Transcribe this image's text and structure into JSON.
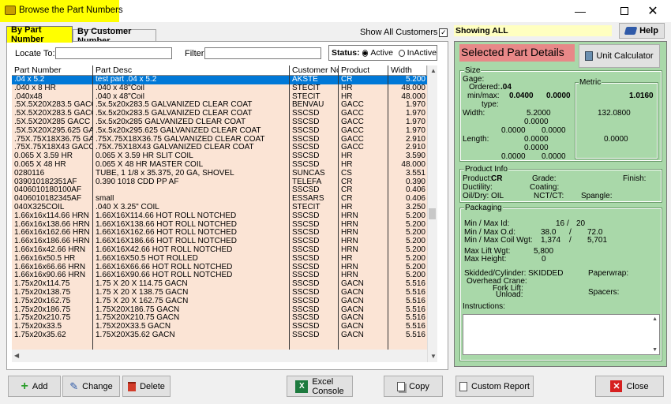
{
  "window": {
    "title": "Browse the Part Numbers"
  },
  "tabs": {
    "by_part": "By Part Number",
    "by_customer": "By Customer Number"
  },
  "show_all_customers": "Show All Customers",
  "locate_label": "Locate To:",
  "filter_label": "Filter:",
  "status": {
    "label": "Status:",
    "active": "Active",
    "inactive": "InActive"
  },
  "columns": [
    "Part Number",
    "Part Desc",
    "Customer No",
    "Product",
    "Width"
  ],
  "rows": [
    {
      "part": ".04 x 5.2",
      "desc": "test part .04 x 5.2",
      "cust": "AKSTE",
      "prod": "CR",
      "width": "5.200"
    },
    {
      "part": ".040 x 8 HR",
      "desc": ".040 x 48\"Coil",
      "cust": "STECIT",
      "prod": "HR",
      "width": "48.000"
    },
    {
      "part": ".040x48",
      "desc": ".040 x 48\"Coil",
      "cust": "STECIT",
      "prod": "HR",
      "width": "48.000"
    },
    {
      "part": ".5X.5X20X283.5 GACC",
      "desc": ".5x.5x20x283.5 GALVANIZED CLEAR COAT",
      "cust": "BENVAU",
      "prod": "GACC",
      "width": "1.970"
    },
    {
      "part": ".5X.5X20X283.5 GACC",
      "desc": ".5x.5x20x283.5 GALVANIZED CLEAR COAT",
      "cust": "SSCSD",
      "prod": "GACC",
      "width": "1.970"
    },
    {
      "part": ".5X.5X20X285 GACC",
      "desc": ".5x.5x20x285 GALVANIZED CLEAR COAT",
      "cust": "SSCSD",
      "prod": "GACC",
      "width": "1.970"
    },
    {
      "part": ".5X.5X20X295.625 GACC",
      "desc": ".5x.5x20x295.625 GALVANIZED CLEAR COAT",
      "cust": "SSCSD",
      "prod": "GACC",
      "width": "1.970"
    },
    {
      "part": ".75X.75X18X36.75 GACC",
      "desc": ".75X.75X18X36.75 GALVANIZED CLEAR COAT",
      "cust": "SSCSD",
      "prod": "GACC",
      "width": "2.910"
    },
    {
      "part": ".75X.75X18X43 GACC",
      "desc": ".75X.75X18X43 GALVANIZED CLEAR COAT",
      "cust": "SSCSD",
      "prod": "GACC",
      "width": "2.910"
    },
    {
      "part": "0.065 X 3.59 HR",
      "desc": "0.065 X 3.59 HR SLIT COIL",
      "cust": "SSCSD",
      "prod": "HR",
      "width": "3.590"
    },
    {
      "part": "0.065 X 48 HR",
      "desc": "0.065 X 48 HR MASTER COIL",
      "cust": "SSCSD",
      "prod": "HR",
      "width": "48.000"
    },
    {
      "part": "0280116",
      "desc": "TUBE, 1 1/8 x 35.375, 20 GA, SHOVEL",
      "cust": "SUNCAS",
      "prod": "CS",
      "width": "3.551"
    },
    {
      "part": "039010182351AF",
      "desc": "0.390 1018 CDD PP AF",
      "cust": "TELEFA",
      "prod": "CR",
      "width": "0.390"
    },
    {
      "part": "0406010180100AF",
      "desc": "",
      "cust": "SSCSD",
      "prod": "CR",
      "width": "0.406"
    },
    {
      "part": "0406010182345AF",
      "desc": "small",
      "cust": "ESSARS",
      "prod": "CR",
      "width": "0.406"
    },
    {
      "part": "040X325COIL",
      "desc": ".040 X 3.25\" COIL",
      "cust": "STECIT",
      "prod": "HR",
      "width": "3.250"
    },
    {
      "part": "1.66x16x114.66 HRN",
      "desc": "1.66X16X114.66 HOT ROLL NOTCHED",
      "cust": "SSCSD",
      "prod": "HRN",
      "width": "5.200"
    },
    {
      "part": "1.66x16x138.66 HRN",
      "desc": "1.66X16X138.66 HOT ROLL NOTCHED",
      "cust": "SSCSD",
      "prod": "HRN",
      "width": "5.200"
    },
    {
      "part": "1.66x16x162.66 HRN",
      "desc": "1.66X16X162.66 HOT ROLL NOTCHED",
      "cust": "SSCSD",
      "prod": "HRN",
      "width": "5.200"
    },
    {
      "part": "1.66x16x186.66 HRN",
      "desc": "1.66X16X186.66 HOT ROLL NOTCHED",
      "cust": "SSCSD",
      "prod": "HRN",
      "width": "5.200"
    },
    {
      "part": "1.66x16x42.66 HRN",
      "desc": "1.66X16X42.66 HOT ROLL NOTCHED",
      "cust": "SSCSD",
      "prod": "HRN",
      "width": "5.200"
    },
    {
      "part": "1.66x16x50.5 HR",
      "desc": "1.66X16X50.5 HOT ROLLED",
      "cust": "SSCSD",
      "prod": "HR",
      "width": "5.200"
    },
    {
      "part": "1.66x16x66.66 HRN",
      "desc": "1.66X16X66.66 HOT ROLL NOTCHED",
      "cust": "SSCSD",
      "prod": "HRN",
      "width": "5.200"
    },
    {
      "part": "1.66x16x90.66 HRN",
      "desc": "1.66X16X90.66 HOT ROLL NOTCHED",
      "cust": "SSCSD",
      "prod": "HRN",
      "width": "5.200"
    },
    {
      "part": "1.75x20x114.75",
      "desc": "1.75 X 20 X 114.75 GACN",
      "cust": "SSCSD",
      "prod": "GACN",
      "width": "5.516"
    },
    {
      "part": "1.75x20x138.75",
      "desc": "1.75 X 20 X 138.75 GACN",
      "cust": "SSCSD",
      "prod": "GACN",
      "width": "5.516"
    },
    {
      "part": "1.75x20x162.75",
      "desc": "1.75 X 20 X 162.75 GACN",
      "cust": "SSCSD",
      "prod": "GACN",
      "width": "5.516"
    },
    {
      "part": "1.75x20x186.75",
      "desc": "1.75X20X186.75 GACN",
      "cust": "SSCSD",
      "prod": "GACN",
      "width": "5.516"
    },
    {
      "part": "1.75x20x210.75",
      "desc": "1.75X20X210.75 GACN",
      "cust": "SSCSD",
      "prod": "GACN",
      "width": "5.516"
    },
    {
      "part": "1.75x20x33.5",
      "desc": "1.75X20X33.5 GACN",
      "cust": "SSCSD",
      "prod": "GACN",
      "width": "5.516"
    },
    {
      "part": "1.75x20x35.62",
      "desc": "1.75X20X35.62 GACN",
      "cust": "SSCSD",
      "prod": "GACN",
      "width": "5.516"
    }
  ],
  "showing": "Showing ALL",
  "help": "Help",
  "details": {
    "title": "Selected Part Details",
    "unit_calc": "Unit Calculator",
    "size": {
      "label": "Size",
      "gage": "Gage:",
      "ordered": "Ordered:",
      "ordered_val": ".04",
      "minmax": "min/max:",
      "min_val": "0.0400",
      "max_val": "0.0000",
      "type": "type:",
      "metric": "Metric",
      "metric_gage": "1.0160",
      "width_label": "Width:",
      "width_val": "5.2000",
      "width_min": "0.0000",
      "width_a": "0.0000",
      "width_b": "0.0000",
      "metric_width": "132.0800",
      "length_label": "Length:",
      "len_a": "0.0000",
      "len_b": "0.0000",
      "len_c": "0.0000",
      "len_d": "0.0000",
      "metric_len": "0.0000"
    },
    "product": {
      "label": "Product Info",
      "product": "Product:",
      "product_val": "CR",
      "grade": "Grade:",
      "finish": "Finish:",
      "ductility": "Ductility:",
      "coating": "Coating:",
      "oildry": "Oil/Dry:",
      "oildry_val": "OIL",
      "nctct": "NCT/CT:",
      "spangle": "Spangle:"
    },
    "packaging": {
      "label": "Packaging",
      "minmax_id": "Min / Max Id:",
      "id_min": "16",
      "id_max": "20",
      "minmax_od": "Min / Max O.d:",
      "od_min": "38.0",
      "od_max": "72.0",
      "minmax_wgt": "Min / Max Coil Wgt:",
      "wgt_min": "1,374",
      "wgt_max": "5,701",
      "max_lift": "Max Lift Wgt:",
      "max_lift_val": "5,800",
      "max_height": "Max Height:",
      "max_height_val": "0",
      "skidded": "Skidded/Cylinder:",
      "skidded_val": "SKIDDED",
      "paperwrap": "Paperwrap:",
      "overhead": "Overhead Crane:",
      "forklift": "Fork Lift:",
      "unload": "Unload:",
      "spacers": "Spacers:",
      "instructions": "Instructions:",
      "slash": "/"
    }
  },
  "buttons": {
    "add": "Add",
    "change": "Change",
    "delete": "Delete",
    "excel1": "Excel",
    "excel2": "Console",
    "copy": "Copy",
    "custom_report": "Custom Report",
    "close": "Close"
  },
  "colors": {
    "title_highlight": "#ffff00",
    "grid_bg": "#fbe4d5",
    "selected_row": "#0078d7",
    "details_bg": "#a9d8a9",
    "details_title": "#e88888"
  }
}
